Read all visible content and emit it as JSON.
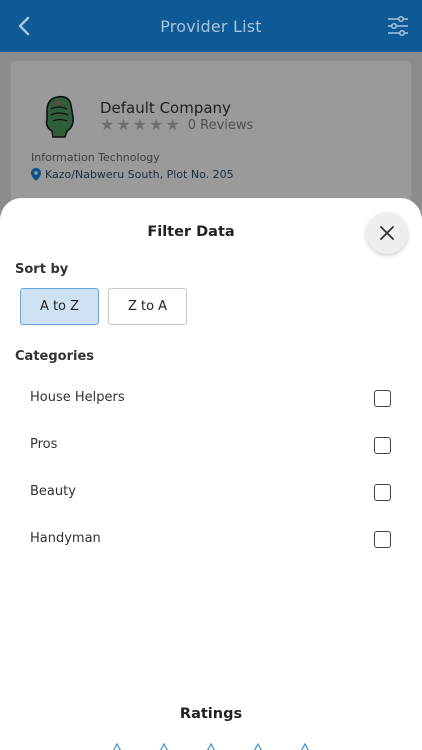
{
  "header": {
    "title": "Provider List"
  },
  "card": {
    "company_name": "Default Company",
    "reviews": "0 Reviews",
    "category": "Information Technology",
    "address": "Kazo/Nabweru South, Plot No. 205",
    "rating": 0
  },
  "sheet": {
    "title": "Filter Data",
    "sort_label": "Sort by",
    "sort_options": [
      {
        "label": "A to Z",
        "selected": true
      },
      {
        "label": "Z to A",
        "selected": false
      }
    ],
    "categories_label": "Categories",
    "categories": [
      {
        "label": "House Helpers",
        "checked": false
      },
      {
        "label": "Pros",
        "checked": false
      },
      {
        "label": "Beauty",
        "checked": false
      },
      {
        "label": "Handyman",
        "checked": false
      }
    ],
    "ratings_label": "Ratings"
  },
  "colors": {
    "header_bg": "#0d5a96",
    "selected_bg": "#cfe2f3",
    "selected_border": "#6aa3d3"
  }
}
